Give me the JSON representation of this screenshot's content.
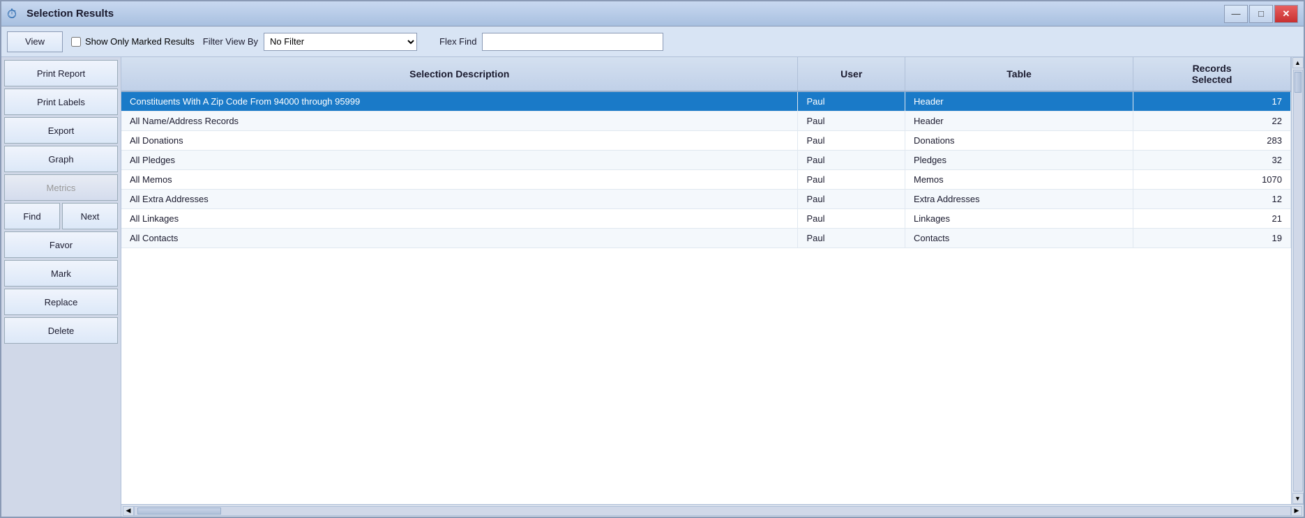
{
  "window": {
    "title": "Selection Results",
    "icon": "⏱"
  },
  "titleButtons": {
    "minimize": "—",
    "maximize": "□",
    "close": "✕"
  },
  "toolbar": {
    "viewLabel": "View",
    "showOnlyMarkedLabel": "Show Only Marked Results",
    "filterViewByLabel": "Filter View By",
    "flexFindLabel": "Flex Find",
    "filterOptions": [
      "No Filter"
    ],
    "filterSelected": "No Filter",
    "flexFindValue": ""
  },
  "sidebar": {
    "buttons": [
      {
        "label": "Print Report",
        "name": "print-report-button",
        "disabled": false
      },
      {
        "label": "Print Labels",
        "name": "print-labels-button",
        "disabled": false
      },
      {
        "label": "Export",
        "name": "export-button",
        "disabled": false
      },
      {
        "label": "Graph",
        "name": "graph-button",
        "disabled": false
      },
      {
        "label": "Metrics",
        "name": "metrics-button",
        "disabled": true
      }
    ],
    "findLabel": "Find",
    "nextLabel": "Next",
    "favorLabel": "Favor",
    "markLabel": "Mark",
    "replaceLabel": "Replace",
    "deleteLabel": "Delete"
  },
  "table": {
    "columns": [
      {
        "label": "Selection Description",
        "name": "col-selection-description"
      },
      {
        "label": "User",
        "name": "col-user"
      },
      {
        "label": "Table",
        "name": "col-table"
      },
      {
        "label": "Records\nSelected",
        "name": "col-records-selected"
      }
    ],
    "rows": [
      {
        "description": "Constituents With A Zip Code From 94000 through 95999",
        "user": "Paul",
        "table": "Header",
        "records": 17,
        "selected": true
      },
      {
        "description": "All Name/Address Records",
        "user": "Paul",
        "table": "Header",
        "records": 22,
        "selected": false
      },
      {
        "description": "All Donations",
        "user": "Paul",
        "table": "Donations",
        "records": 283,
        "selected": false
      },
      {
        "description": "All Pledges",
        "user": "Paul",
        "table": "Pledges",
        "records": 32,
        "selected": false
      },
      {
        "description": "All Memos",
        "user": "Paul",
        "table": "Memos",
        "records": 1070,
        "selected": false
      },
      {
        "description": "All Extra Addresses",
        "user": "Paul",
        "table": "Extra Addresses",
        "records": 12,
        "selected": false
      },
      {
        "description": "All Linkages",
        "user": "Paul",
        "table": "Linkages",
        "records": 21,
        "selected": false
      },
      {
        "description": "All Contacts",
        "user": "Paul",
        "table": "Contacts",
        "records": 19,
        "selected": false
      }
    ]
  }
}
